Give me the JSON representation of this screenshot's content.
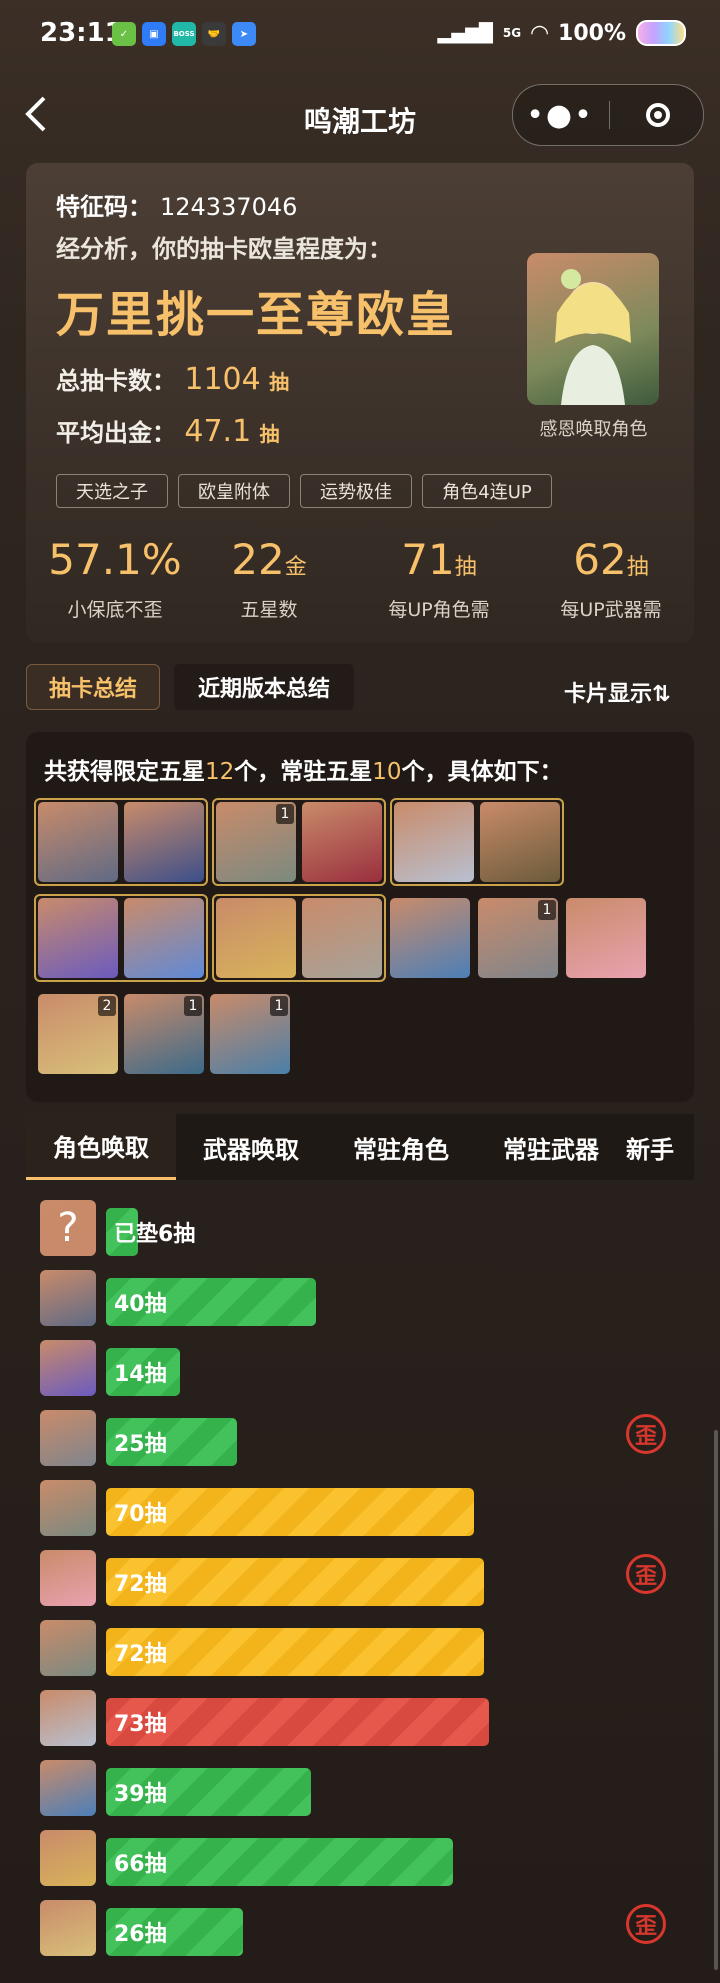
{
  "status_bar": {
    "time": "23:11",
    "apps": [
      {
        "name": "check-app-icon",
        "color": "#6bc046",
        "text": "✓"
      },
      {
        "name": "chat-app-icon",
        "color": "#2f7cf6",
        "text": "▣"
      },
      {
        "name": "boss-app-icon",
        "color": "#22b8a8",
        "text": "BOSS"
      },
      {
        "name": "handshake-icon",
        "color": "#3a3a3a",
        "text": "🤝"
      },
      {
        "name": "send-app-icon",
        "color": "#3d8af7",
        "text": "➤"
      }
    ],
    "network": "5G",
    "battery": "100%"
  },
  "header": {
    "title": "鸣潮工坊",
    "more_icon": "•●•"
  },
  "summary": {
    "signature_label": "特征码：",
    "signature_value": "124337046",
    "analysis_text": "经分析，你的抽卡欧皇程度为：",
    "rank_title": "万里挑一至尊欧皇",
    "total_label": "总抽卡数：",
    "total_value": "1104",
    "total_unit": "抽",
    "avg_label": "平均出金：",
    "avg_value": "47.1",
    "avg_unit": "抽",
    "featured_caption": "感恩唤取角色",
    "tags": [
      "天选之子",
      "欧皇附体",
      "运势极佳",
      "角色4连UP"
    ],
    "stats": [
      {
        "value": "57.1%",
        "unit": "",
        "label": "小保底不歪"
      },
      {
        "value": "22",
        "unit": "金",
        "label": "五星数"
      },
      {
        "value": "71",
        "unit": "抽",
        "label": "每UP角色需"
      },
      {
        "value": "62",
        "unit": "抽",
        "label": "每UP武器需"
      }
    ]
  },
  "view_tabs": {
    "summary": "抽卡总结",
    "recent": "近期版本总结",
    "card_toggle": "卡片显示⇅"
  },
  "five_star": {
    "prefix": "共获得限定五星",
    "limited_count": "12",
    "mid": "个，常驻五星",
    "standard_count": "10",
    "suffix": "个，具体如下：",
    "badges": [
      "1",
      "1",
      "2",
      "1",
      "1"
    ]
  },
  "pull_tabs": [
    "角色唤取",
    "武器唤取",
    "常驻角色",
    "常驻武器",
    "新手"
  ],
  "history": [
    {
      "label": "已垫6抽",
      "pulls": 6,
      "color": "green",
      "waist": false,
      "avatar": "#c9896b"
    },
    {
      "label": "40抽",
      "pulls": 40,
      "color": "green",
      "waist": false,
      "avatar": "#5f6a85"
    },
    {
      "label": "14抽",
      "pulls": 14,
      "color": "green",
      "waist": false,
      "avatar": "#6a5bbf"
    },
    {
      "label": "25抽",
      "pulls": 25,
      "color": "green",
      "waist": true,
      "avatar": "#7f858c"
    },
    {
      "label": "70抽",
      "pulls": 70,
      "color": "yellow",
      "waist": false,
      "avatar": "#7b8a80"
    },
    {
      "label": "72抽",
      "pulls": 72,
      "color": "yellow",
      "waist": true,
      "avatar": "#e8a2b0"
    },
    {
      "label": "72抽",
      "pulls": 72,
      "color": "yellow",
      "waist": false,
      "avatar": "#7b8a80"
    },
    {
      "label": "73抽",
      "pulls": 73,
      "color": "red",
      "waist": false,
      "avatar": "#b8c0d0"
    },
    {
      "label": "39抽",
      "pulls": 39,
      "color": "green",
      "waist": false,
      "avatar": "#4c7fb8"
    },
    {
      "label": "66抽",
      "pulls": 66,
      "color": "green",
      "waist": false,
      "avatar": "#d8b35a"
    },
    {
      "label": "26抽",
      "pulls": 26,
      "color": "green",
      "waist": true,
      "avatar": "#d8c07a"
    }
  ],
  "waist_icon": "歪",
  "placeholder_icon": "?",
  "colors": {
    "gold": "#f7c06a",
    "green": "#36b24d",
    "yellow": "#f3b31a",
    "red": "#d84a40"
  }
}
